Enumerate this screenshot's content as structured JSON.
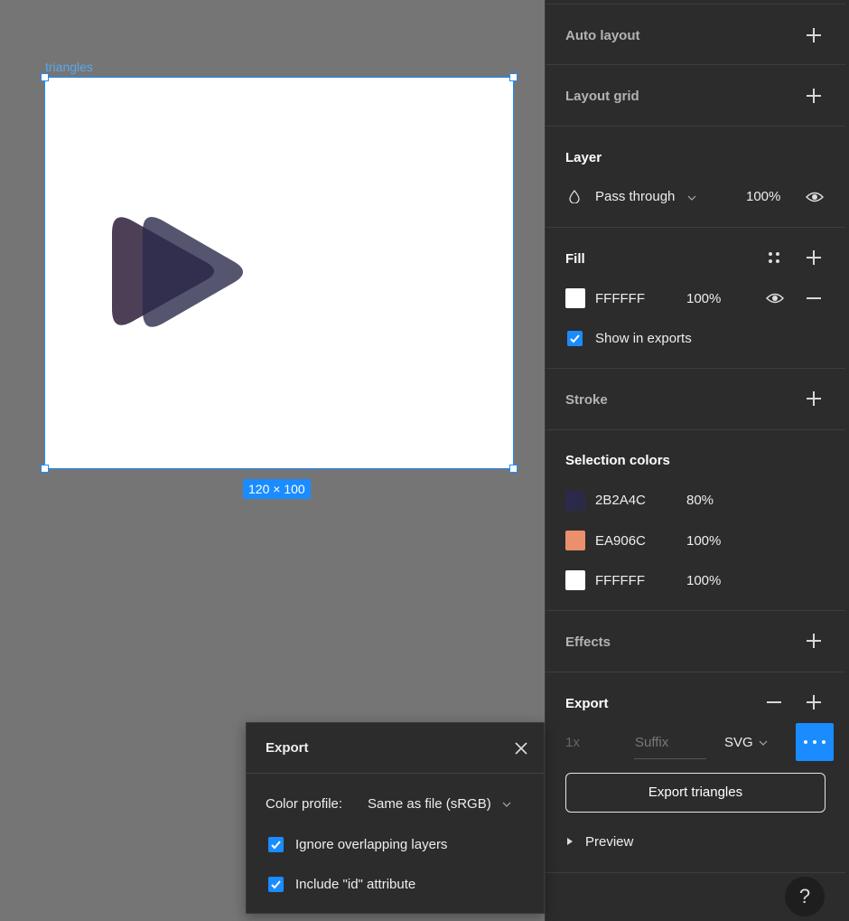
{
  "canvas": {
    "frame_name": "triangles",
    "size_badge": "120 × 100"
  },
  "panel": {
    "auto_layout": "Auto layout",
    "layout_grid": "Layout grid",
    "layer": {
      "title": "Layer",
      "blend_mode": "Pass through",
      "opacity": "100%"
    },
    "fill": {
      "title": "Fill",
      "hex": "FFFFFF",
      "opacity": "100%",
      "show_in_exports": "Show in exports"
    },
    "stroke": "Stroke",
    "selection_colors": {
      "title": "Selection colors",
      "items": [
        {
          "hex": "2B2A4C",
          "opacity": "80%",
          "color": "#2B2A4C"
        },
        {
          "hex": "EA906C",
          "opacity": "100%",
          "color": "#EA906C"
        },
        {
          "hex": "FFFFFF",
          "opacity": "100%",
          "color": "#FFFFFF"
        }
      ]
    },
    "effects": "Effects",
    "export": {
      "title": "Export",
      "scale": "1x",
      "suffix_placeholder": "Suffix",
      "format": "SVG",
      "export_button": "Export triangles",
      "preview": "Preview"
    },
    "help": "?"
  },
  "popup": {
    "title": "Export",
    "color_profile_label": "Color profile:",
    "color_profile_value": "Same as file (sRGB)",
    "ignore_overlapping": "Ignore overlapping layers",
    "include_id": "Include \"id\" attribute"
  },
  "colors": {
    "accent": "#1a8cff",
    "panel_bg": "#2c2c2c",
    "canvas_bg": "#757575"
  }
}
